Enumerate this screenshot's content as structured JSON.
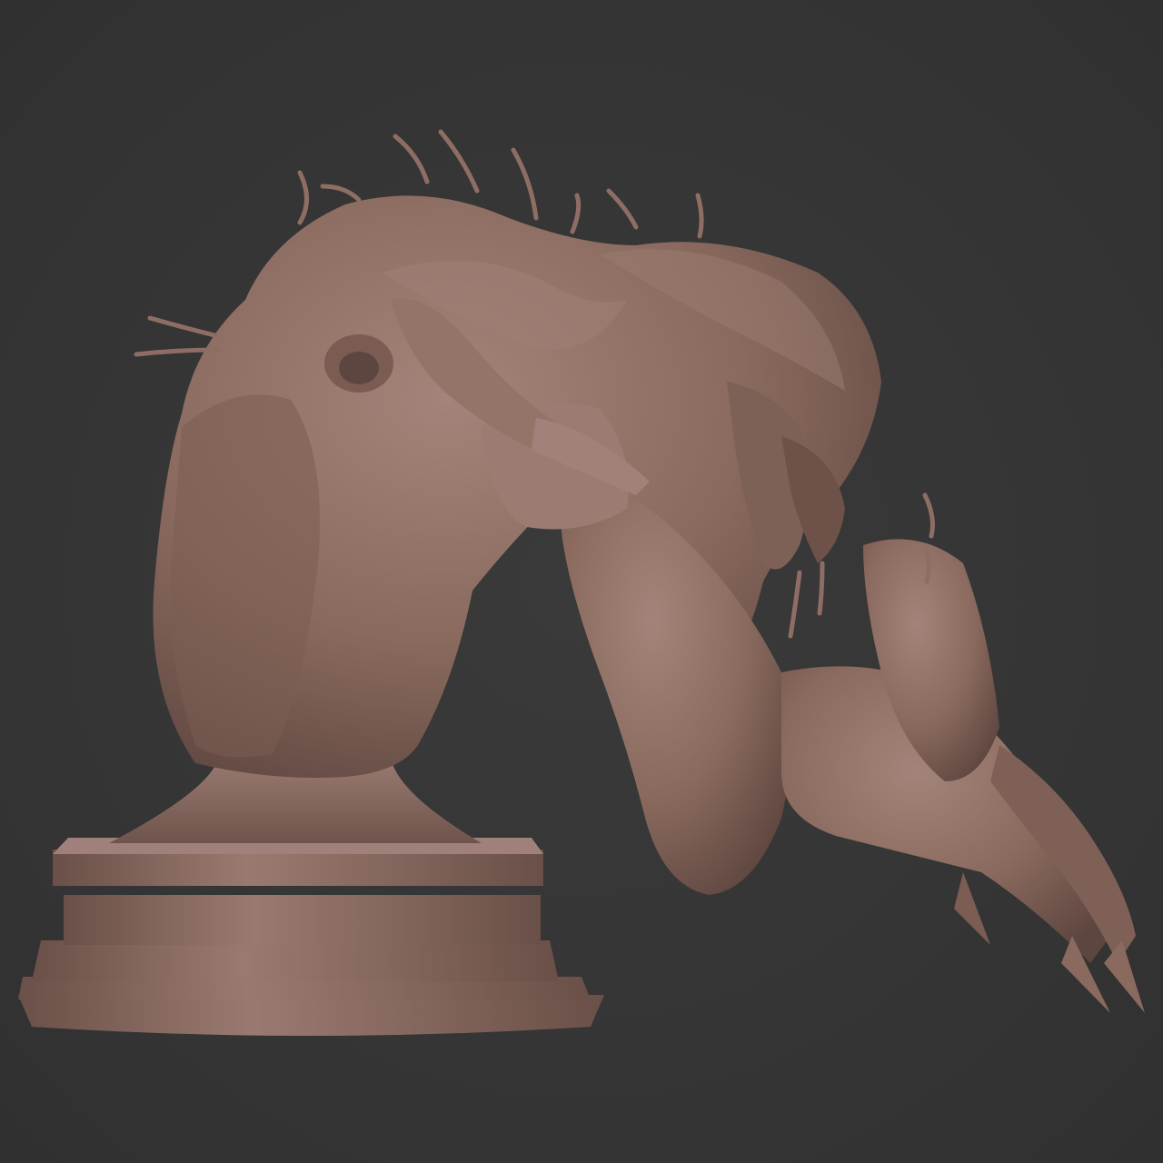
{
  "viewport": {
    "background_color": "#353535"
  },
  "sculpt": {
    "subject": "creature-bust-sculpt",
    "material_color": "#8a6a5e",
    "highlight_color": "#a3847a",
    "shadow_color": "#5e4640"
  }
}
